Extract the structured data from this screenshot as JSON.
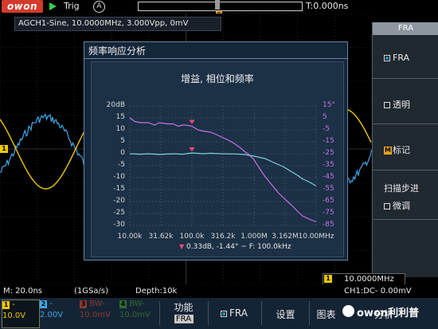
{
  "top_bar": {
    "logo": "owon",
    "run_state_icon": "play-icon",
    "trig_label": "Trig",
    "trig_mode_icon": "auto-trigger-icon",
    "trig_mode_glyph": "A",
    "trigger_position_marker": "T",
    "time_position": "T:0.000ns"
  },
  "scope": {
    "info_line": "AGCH1-Sine, 10.0000MHz, 3.000Vpp, 0mV",
    "ch1_marker": "1",
    "colors": {
      "ch1": "#f0c800",
      "ch2": "#3ea7e8",
      "grid": "#3a3a3a",
      "gain": "#7ed1d6",
      "phase": "#c673e6"
    }
  },
  "fra_window": {
    "title": "频率响应分析",
    "plot_title": "增益, 相位和频率",
    "gain_axis_ticks": [
      "20dB",
      "15",
      "10",
      "5",
      "0",
      "-5",
      "-10",
      "-15",
      "-20",
      "-25",
      "-30"
    ],
    "phase_axis_ticks": [
      "15°",
      "5",
      "-5",
      "-15",
      "-25",
      "-35",
      "-45",
      "-55",
      "-65",
      "-75",
      "-85"
    ],
    "x_ticks": [
      "10.00k",
      "31.62k",
      "100.0k",
      "316.2k",
      "1.000M",
      "3.162M",
      "10.00MHz"
    ],
    "cursor_readout": "0.33dB, -1.44° ~ F: 100.0kHz",
    "cursor_icon": "cursor-marker-icon"
  },
  "chart_data": {
    "type": "line",
    "title": "增益, 相位和频率",
    "x_scale": "log",
    "x_range_hz": [
      10000,
      10000000
    ],
    "x_ticks": [
      "10.00k",
      "31.62k",
      "100.0k",
      "316.2k",
      "1.000M",
      "3.162M",
      "10.00MHz"
    ],
    "y_left_range": [
      -30,
      20
    ],
    "y_right_range": [
      -85,
      15
    ],
    "series": [
      {
        "axis": "right",
        "color": "#c673e6",
        "x_hz": [
          10000,
          12000,
          15000,
          20000,
          25000,
          30000,
          40000,
          50000,
          60000,
          70000,
          80000,
          100000,
          125000,
          150000,
          200000,
          250000,
          300000,
          400000,
          500000,
          600000,
          700000,
          800000,
          1000000,
          1250000,
          1500000,
          2000000,
          2500000,
          3000000,
          4000000,
          5000000,
          6000000,
          8000000,
          10000000
        ],
        "values": [
          5,
          2,
          1,
          1,
          -1,
          1,
          0,
          0,
          -2,
          -1,
          -1,
          -2,
          -5,
          -6,
          -7,
          -9,
          -11,
          -14,
          -17,
          -20,
          -23,
          -25,
          -30,
          -38,
          -44,
          -52,
          -58,
          -62,
          -68,
          -73,
          -77,
          -80,
          -82
        ]
      },
      {
        "axis": "left",
        "color": "#7ed1d6",
        "x_hz": [
          10000,
          15000,
          20000,
          30000,
          50000,
          70000,
          100000,
          150000,
          200000,
          300000,
          500000,
          700000,
          1000000,
          1500000,
          2000000,
          3000000,
          4000000,
          5000000,
          6000000,
          8000000,
          10000000
        ],
        "values": [
          0,
          -0.2,
          0,
          -0.3,
          0,
          -0.2,
          0.33,
          0,
          0.2,
          0,
          -0.1,
          -0.3,
          -1,
          -2,
          -3.5,
          -5.5,
          -7.5,
          -9,
          -10.5,
          -12,
          -13.5
        ]
      }
    ],
    "cursor": {
      "x_hz": 100000,
      "gain_db": 0.33,
      "phase_deg": -1.44
    }
  },
  "menu": {
    "title": "FRA",
    "fra_toggle": "FRA",
    "transparent": "透明",
    "marker_glyph": "M",
    "marker": "标记",
    "sweep_step": "扫描步进",
    "fine_tune": "微调"
  },
  "status_bar": {
    "timebase": "M: 20.0ns",
    "sample_rate": "(1GSa/s)",
    "depth": "Depth:10k",
    "trig_source_marker": "1",
    "trig_freq": "10.0000MHz",
    "trig_info": "CH1:DC- 0.00mV"
  },
  "bottom_bar": {
    "ch1": {
      "num": "1",
      "line1": "-",
      "line2": "10.0V"
    },
    "ch2": {
      "num": "2",
      "line1": "-",
      "line2": "2.00V"
    },
    "ch3": {
      "num": "3",
      "line1": "BW-",
      "line2": "10.0mV"
    },
    "ch4": {
      "num": "4",
      "line1": "BW-",
      "line2": "10.0mV"
    },
    "function_label": "功能",
    "function_value": "FRA",
    "fra_key": "FRA",
    "settings_key": "设置",
    "chart_key": "图表",
    "analysis_key": "分析",
    "watermark": "owon利利普"
  }
}
